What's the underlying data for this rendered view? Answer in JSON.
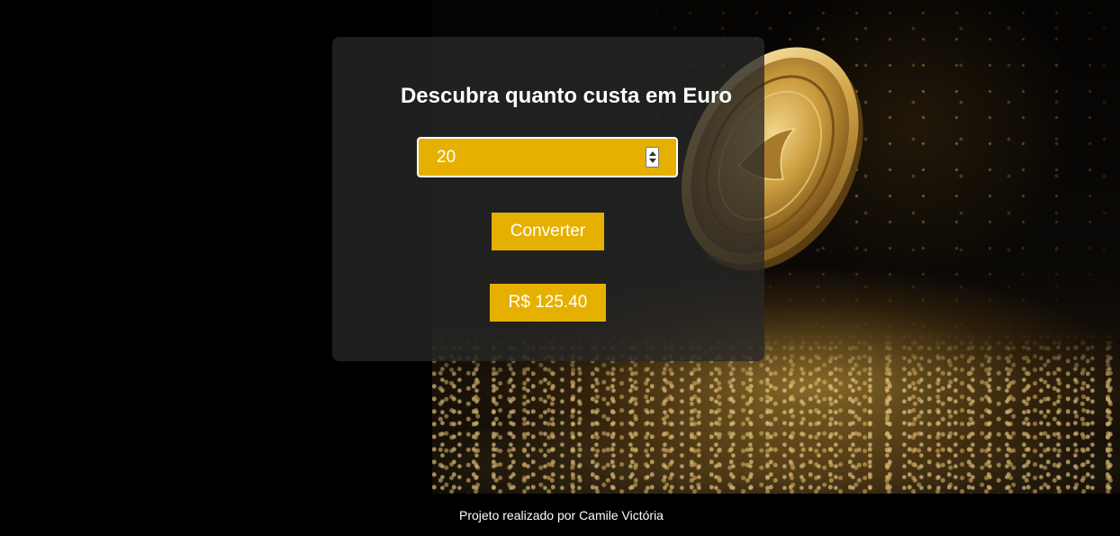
{
  "converter": {
    "title": "Descubra quanto custa em Euro",
    "amount_value": "20",
    "convert_label": "Converter",
    "result_text": "R$ 125.40"
  },
  "footer": {
    "credit": "Projeto realizado por Camile Victória"
  },
  "colors": {
    "accent": "#e6b000",
    "card_background": "#282828",
    "page_background": "#000000"
  },
  "icons": {
    "spinner": "number-stepper-arrows"
  }
}
